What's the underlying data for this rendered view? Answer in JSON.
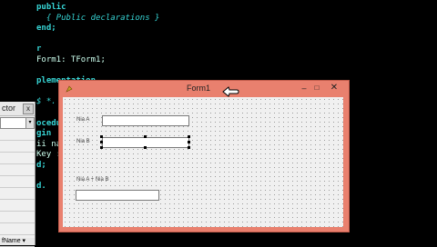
{
  "editor": {
    "lines": [
      {
        "text": "public",
        "cls": "kw"
      },
      {
        "text": "  { Public declarations }",
        "cls": "cm"
      },
      {
        "text": "end;",
        "cls": "kw"
      },
      {
        "text": "",
        "cls": "tx"
      },
      {
        "text": "r",
        "cls": "kw"
      },
      {
        "text": "Form1: TForm1;",
        "cls": "tx"
      },
      {
        "text": "",
        "cls": "tx"
      },
      {
        "text": "plementation",
        "cls": "kw"
      },
      {
        "text": "",
        "cls": "tx"
      },
      {
        "text": "$ *.",
        "cls": "cm"
      },
      {
        "text": "",
        "cls": "tx"
      },
      {
        "text": "ocedu",
        "cls": "kw"
      },
      {
        "text": "gin",
        "cls": "kw"
      },
      {
        "text": "ii na",
        "cls": "tx"
      },
      {
        "text": "Key :",
        "cls": "tx"
      },
      {
        "text": "d;",
        "cls": "kw"
      },
      {
        "text": "",
        "cls": "tx"
      },
      {
        "text": "d.",
        "cls": "kw"
      }
    ]
  },
  "inspector": {
    "title": "ctor",
    "close_glyph": "x",
    "bottom_text": "fName ▾"
  },
  "form": {
    "title": "Form1",
    "min_glyph": "–",
    "max_glyph": "□",
    "close_glyph": "✕",
    "label_a": "Nia A",
    "label_b": "Nia B",
    "label_sum": "Nia A + Nia B"
  }
}
